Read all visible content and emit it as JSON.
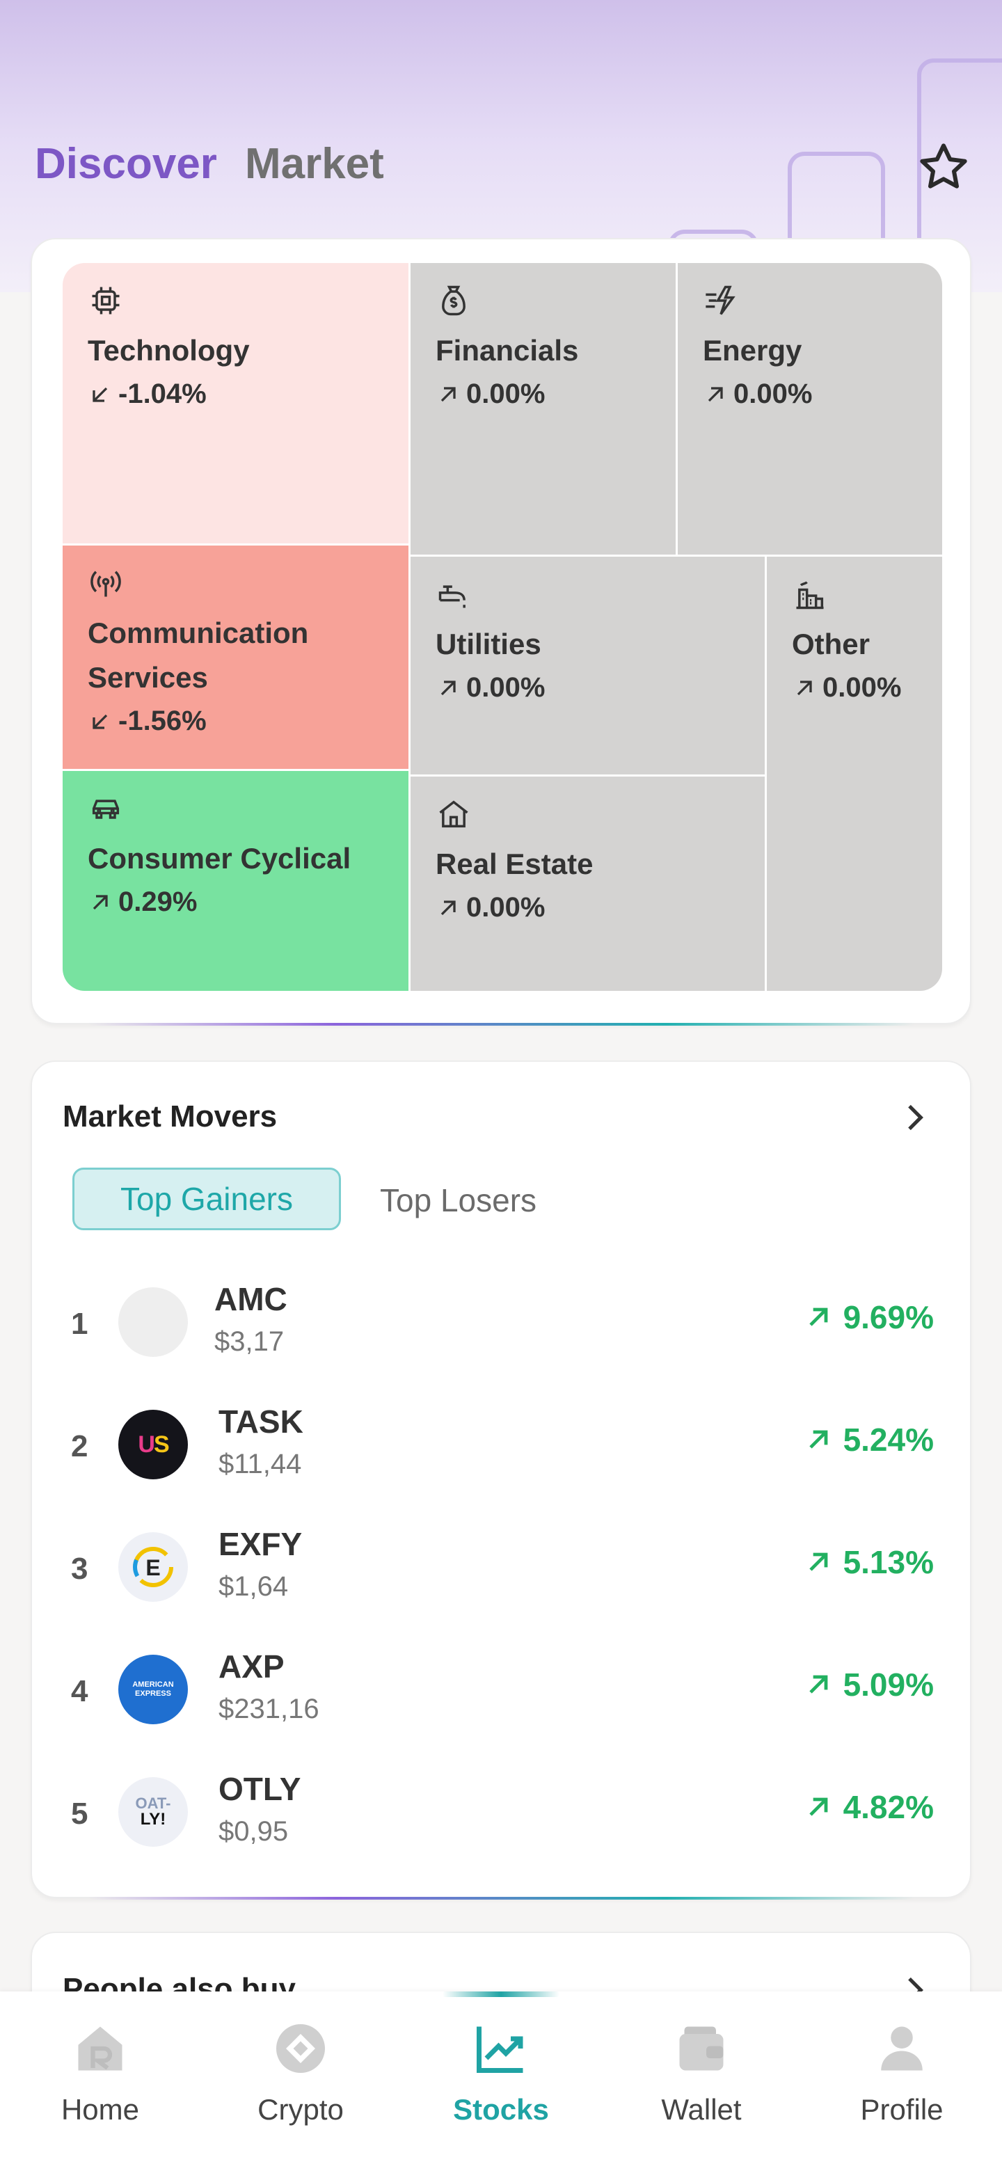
{
  "header": {
    "tab_discover": "Discover",
    "tab_market": "Market",
    "star_icon": "star-icon"
  },
  "sectors": [
    {
      "name": "Technology",
      "change": "-1.04%",
      "direction": "down",
      "color": "#fde4e3",
      "icon": "chip-icon"
    },
    {
      "name": "Financials",
      "change": "0.00%",
      "direction": "up",
      "color": "#d4d3d2",
      "icon": "money-bag-icon"
    },
    {
      "name": "Energy",
      "change": "0.00%",
      "direction": "up",
      "color": "#d4d3d2",
      "icon": "bolt-icon"
    },
    {
      "name": "Communication Services",
      "name_line1": "Communication",
      "name_line2": "Services",
      "change": "-1.56%",
      "direction": "down",
      "color": "#f7a298",
      "icon": "broadcast-icon"
    },
    {
      "name": "Utilities",
      "change": "0.00%",
      "direction": "up",
      "color": "#d4d3d2",
      "icon": "faucet-icon"
    },
    {
      "name": "Other",
      "change": "0.00%",
      "direction": "up",
      "color": "#d4d3d2",
      "icon": "factory-icon"
    },
    {
      "name": "Consumer Cyclical",
      "change": "0.29%",
      "direction": "up",
      "color": "#78e2a0",
      "icon": "car-icon"
    },
    {
      "name": "Real Estate",
      "change": "0.00%",
      "direction": "up",
      "color": "#d4d3d2",
      "icon": "house-icon"
    }
  ],
  "movers": {
    "title": "Market Movers",
    "tab_gainers": "Top Gainers",
    "tab_losers": "Top Losers",
    "rows": [
      {
        "rank": "1",
        "symbol": "AMC",
        "price": "$3,17",
        "change": "9.69%"
      },
      {
        "rank": "2",
        "symbol": "TASK",
        "price": "$11,44",
        "change": "5.24%"
      },
      {
        "rank": "3",
        "symbol": "EXFY",
        "price": "$1,64",
        "change": "5.13%"
      },
      {
        "rank": "4",
        "symbol": "AXP",
        "price": "$231,16",
        "change": "5.09%"
      },
      {
        "rank": "5",
        "symbol": "OTLY",
        "price": "$0,95",
        "change": "4.82%"
      }
    ],
    "gain_color": "#22b060"
  },
  "people": {
    "title": "People also buy"
  },
  "nav": {
    "items": [
      {
        "label": "Home",
        "icon": "home-icon"
      },
      {
        "label": "Crypto",
        "icon": "crypto-icon"
      },
      {
        "label": "Stocks",
        "icon": "stocks-chart-icon",
        "active": true
      },
      {
        "label": "Wallet",
        "icon": "wallet-icon"
      },
      {
        "label": "Profile",
        "icon": "profile-icon"
      }
    ],
    "active_color": "#1fa3a4"
  },
  "logo_text": {
    "task": "US",
    "exfy": "E",
    "axp": "AMERICAN EXPRESS",
    "otly": "OAT-LY!"
  }
}
